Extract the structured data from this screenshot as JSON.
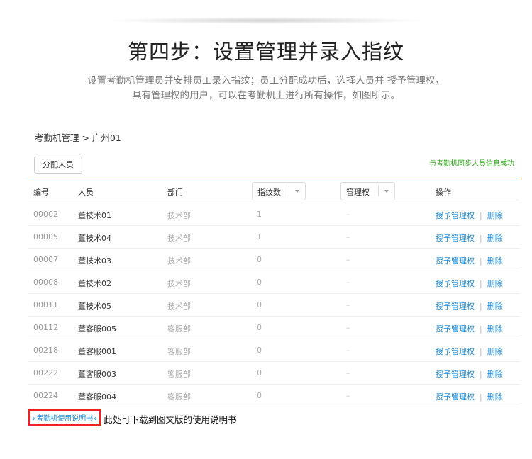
{
  "title": "第四步：设置管理并录入指纹",
  "description": {
    "line1": "设置考勤机管理员并安排员工录入指纹；员工分配成功后，选择人员并 授予管理权，",
    "line2": "具有管理权的用户，可以在考勤机上进行所有操作，如图所示。"
  },
  "breadcrumb": "考勤机管理 > 广州01",
  "assign_button": "分配人员",
  "sync_message": "与考勤机同步人员信息成功",
  "columns": {
    "id": "编号",
    "person": "人员",
    "dept": "部门",
    "fingerprints": "指纹数",
    "admin": "管理权",
    "ops": "操作"
  },
  "rows": [
    {
      "id": "00002",
      "person": "董技术01",
      "dept": "技术部",
      "fingerprints": "1",
      "admin": "–",
      "grant": "授予管理权",
      "sep": "|",
      "delete": "删除"
    },
    {
      "id": "00005",
      "person": "董技术04",
      "dept": "技术部",
      "fingerprints": "1",
      "admin": "–",
      "grant": "授予管理权",
      "sep": "|",
      "delete": "删除"
    },
    {
      "id": "00007",
      "person": "董技术03",
      "dept": "技术部",
      "fingerprints": "0",
      "admin": "–",
      "grant": "授予管理权",
      "sep": "|",
      "delete": "删除"
    },
    {
      "id": "00008",
      "person": "董技术02",
      "dept": "技术部",
      "fingerprints": "0",
      "admin": "–",
      "grant": "授予管理权",
      "sep": "|",
      "delete": "删除"
    },
    {
      "id": "00011",
      "person": "董技术05",
      "dept": "技术部",
      "fingerprints": "0",
      "admin": "–",
      "grant": "授予管理权",
      "sep": "|",
      "delete": "删除"
    },
    {
      "id": "00112",
      "person": "董客服005",
      "dept": "客服部",
      "fingerprints": "0",
      "admin": "–",
      "grant": "授予管理权",
      "sep": "|",
      "delete": "删除"
    },
    {
      "id": "00218",
      "person": "董客服001",
      "dept": "客服部",
      "fingerprints": "0",
      "admin": "–",
      "grant": "授予管理权",
      "sep": "|",
      "delete": "删除"
    },
    {
      "id": "00222",
      "person": "董客服003",
      "dept": "客服部",
      "fingerprints": "0",
      "admin": "–",
      "grant": "授予管理权",
      "sep": "|",
      "delete": "删除"
    },
    {
      "id": "00224",
      "person": "董客服004",
      "dept": "客服部",
      "fingerprints": "0",
      "admin": "–",
      "grant": "授予管理权",
      "sep": "|",
      "delete": "删除"
    }
  ],
  "manual_link": "«考勤机使用说明书»",
  "manual_text": "此处可下载到图文版的使用说明书",
  "colors": {
    "accent_link": "#1a8ad8",
    "success": "#2aa515",
    "highlight_border": "#e22222",
    "table_top_border": "#4db6f0"
  }
}
